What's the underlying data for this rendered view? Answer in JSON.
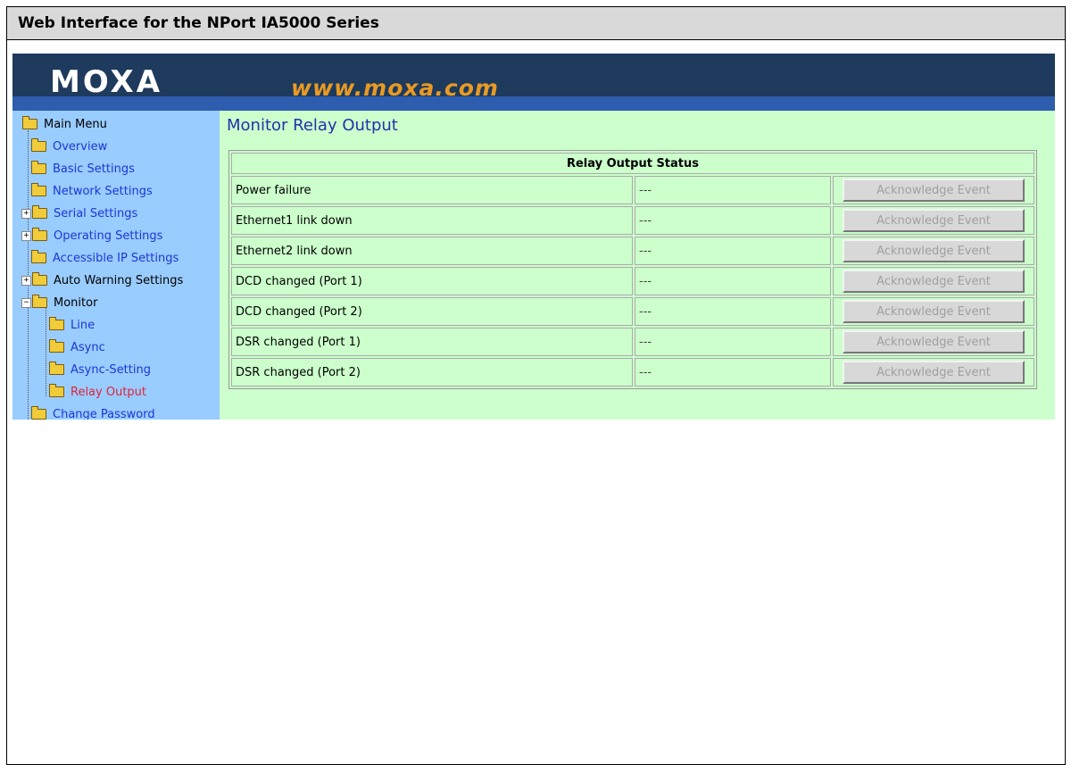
{
  "document": {
    "header_title": "Web Interface for the NPort IA5000 Series"
  },
  "banner": {
    "logo": "MOXA",
    "url": "www.moxa.com"
  },
  "sidebar": {
    "root": "Main Menu",
    "items": [
      {
        "label": "Overview"
      },
      {
        "label": "Basic Settings"
      },
      {
        "label": "Network Settings"
      },
      {
        "label": "Serial Settings"
      },
      {
        "label": "Operating Settings"
      },
      {
        "label": "Accessible IP Settings"
      },
      {
        "label": "Auto Warning Settings"
      },
      {
        "label": "Monitor"
      },
      {
        "label": "Line"
      },
      {
        "label": "Async"
      },
      {
        "label": "Async-Setting"
      },
      {
        "label": "Relay Output"
      },
      {
        "label": "Change Password"
      }
    ]
  },
  "main": {
    "title": "Monitor Relay Output",
    "table_header": "Relay Output Status",
    "rows": [
      {
        "event": "Power failure",
        "status": "---",
        "action": "Acknowledge Event"
      },
      {
        "event": "Ethernet1 link down",
        "status": "---",
        "action": "Acknowledge Event"
      },
      {
        "event": "Ethernet2 link down",
        "status": "---",
        "action": "Acknowledge Event"
      },
      {
        "event": "DCD changed (Port 1)",
        "status": "---",
        "action": "Acknowledge Event"
      },
      {
        "event": "DCD changed (Port 2)",
        "status": "---",
        "action": "Acknowledge Event"
      },
      {
        "event": "DSR changed (Port 1)",
        "status": "---",
        "action": "Acknowledge Event"
      },
      {
        "event": "DSR changed (Port 2)",
        "status": "---",
        "action": "Acknowledge Event"
      }
    ]
  },
  "colors": {
    "banner": "#1e3a5c",
    "banner_stripe": "#2e5cae",
    "url": "#e89a24",
    "sidebar_bg": "#99ccff",
    "content_bg": "#ccffcc",
    "link": "#1a37d6",
    "active_link": "#e0243a"
  }
}
